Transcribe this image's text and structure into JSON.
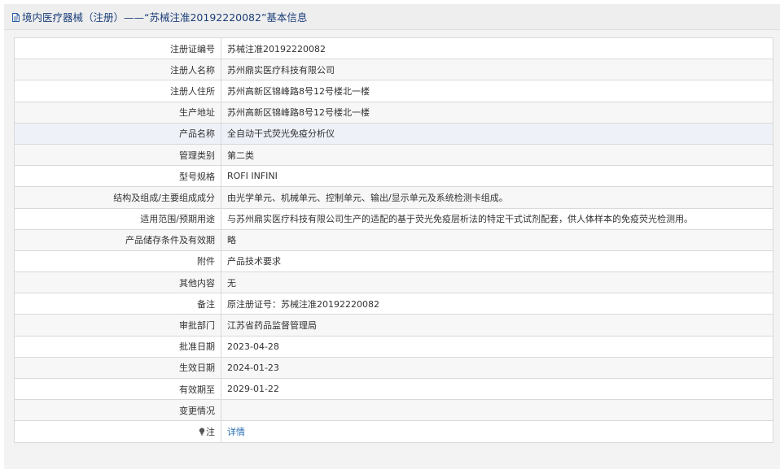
{
  "header": {
    "title": "境内医疗器械（注册）——“苏械注准20192220082”基本信息",
    "icon": "document-icon"
  },
  "rows": [
    {
      "label": "注册证编号",
      "value": "苏械注准20192220082"
    },
    {
      "label": "注册人名称",
      "value": "苏州鼎实医疗科技有限公司"
    },
    {
      "label": "注册人住所",
      "value": "苏州高新区锦峰路8号12号楼北一楼"
    },
    {
      "label": "生产地址",
      "value": "苏州高新区锦峰路8号12号楼北一楼"
    },
    {
      "label": "产品名称",
      "value": "全自动干式荧光免疫分析仪"
    },
    {
      "label": "管理类别",
      "value": "第二类"
    },
    {
      "label": "型号规格",
      "value": "ROFI INFINI"
    },
    {
      "label": "结构及组成/主要组成成分",
      "value": "由光学单元、机械单元、控制单元、输出/显示单元及系统检测卡组成。"
    },
    {
      "label": "适用范围/预期用途",
      "value": "与苏州鼎实医疗科技有限公司生产的适配的基于荧光免疫层析法的特定干式试剂配套，供人体样本的免疫荧光检测用。"
    },
    {
      "label": "产品储存条件及有效期",
      "value": "略"
    },
    {
      "label": "附件",
      "value": "产品技术要求"
    },
    {
      "label": "其他内容",
      "value": "无"
    },
    {
      "label": "备注",
      "value": "原注册证号：苏械注准20192220082"
    },
    {
      "label": "审批部门",
      "value": "江苏省药品监督管理局"
    },
    {
      "label": "批准日期",
      "value": "2023-04-28"
    },
    {
      "label": "生效日期",
      "value": "2024-01-23"
    },
    {
      "label": "有效期至",
      "value": "2029-01-22"
    },
    {
      "label": "变更情况",
      "value": ""
    }
  ],
  "note_row": {
    "label": "注",
    "icon": "lightbulb-icon",
    "link_text": "详情"
  },
  "colors": {
    "header_bg": "#eeeeee",
    "title_text": "#1c3f7a",
    "link": "#2a6eb6",
    "highlight_row": "#eef1f8"
  }
}
